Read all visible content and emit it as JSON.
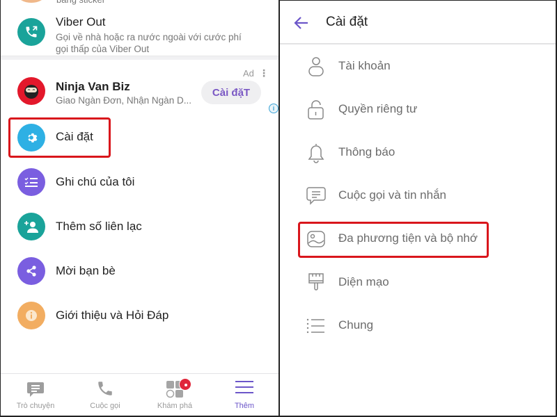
{
  "left": {
    "partial_item_subtitle": "bằng sticker",
    "viber_out": {
      "title": "Viber Out",
      "subtitle_line1": "Gọi về nhà hoặc ra nước ngoài với cước phí",
      "subtitle_line2": "gọi thấp của Viber Out",
      "icon": "phone-outgoing-icon",
      "color": "#1aa39a"
    },
    "ad": {
      "name": "Ninja Van Biz",
      "subtitle": "Giao Ngàn Đơn, Nhận Ngàn D...",
      "badge": "Ad",
      "more": "⋮",
      "button": "Cài đặT",
      "info": "i",
      "avatar_color": "#e3182b"
    },
    "menu": [
      {
        "label": "Cài đặt",
        "icon": "gear-icon",
        "color": "#2eb0e4",
        "highlighted": true
      },
      {
        "label": "Ghi chú của tôi",
        "icon": "checklist-icon",
        "color": "#7a5ee0"
      },
      {
        "label": "Thêm số liên lạc",
        "icon": "add-contact-icon",
        "color": "#1aa39a"
      },
      {
        "label": "Mời bạn bè",
        "icon": "share-icon",
        "color": "#7a5ee0"
      },
      {
        "label": "Giới thiệu và Hỏi Đáp",
        "icon": "info-icon",
        "color": "#f2ad61"
      }
    ],
    "bottom_nav": [
      {
        "label": "Trò chuyện",
        "icon": "chat-icon"
      },
      {
        "label": "Cuộc gọi",
        "icon": "phone-icon"
      },
      {
        "label": "Khám phá",
        "icon": "explore-icon",
        "badge": true
      },
      {
        "label": "Thêm",
        "icon": "menu-icon",
        "active": true
      }
    ]
  },
  "right": {
    "title": "Cài đặt",
    "back_icon": "arrow-left-icon",
    "items": [
      {
        "label": "Tài khoản",
        "icon": "user-icon"
      },
      {
        "label": "Quyền riêng tư",
        "icon": "lock-icon"
      },
      {
        "label": "Thông báo",
        "icon": "bell-icon"
      },
      {
        "label": "Cuộc gọi và tin nhắn",
        "icon": "message-icon"
      },
      {
        "label": "Đa phương tiện và bộ nhớ",
        "icon": "image-icon",
        "highlighted": true
      },
      {
        "label": "Diện mạo",
        "icon": "brush-icon"
      },
      {
        "label": "Chung",
        "icon": "list-icon"
      }
    ]
  },
  "colors": {
    "accent": "#6c56c9",
    "highlight": "#d9161c"
  }
}
